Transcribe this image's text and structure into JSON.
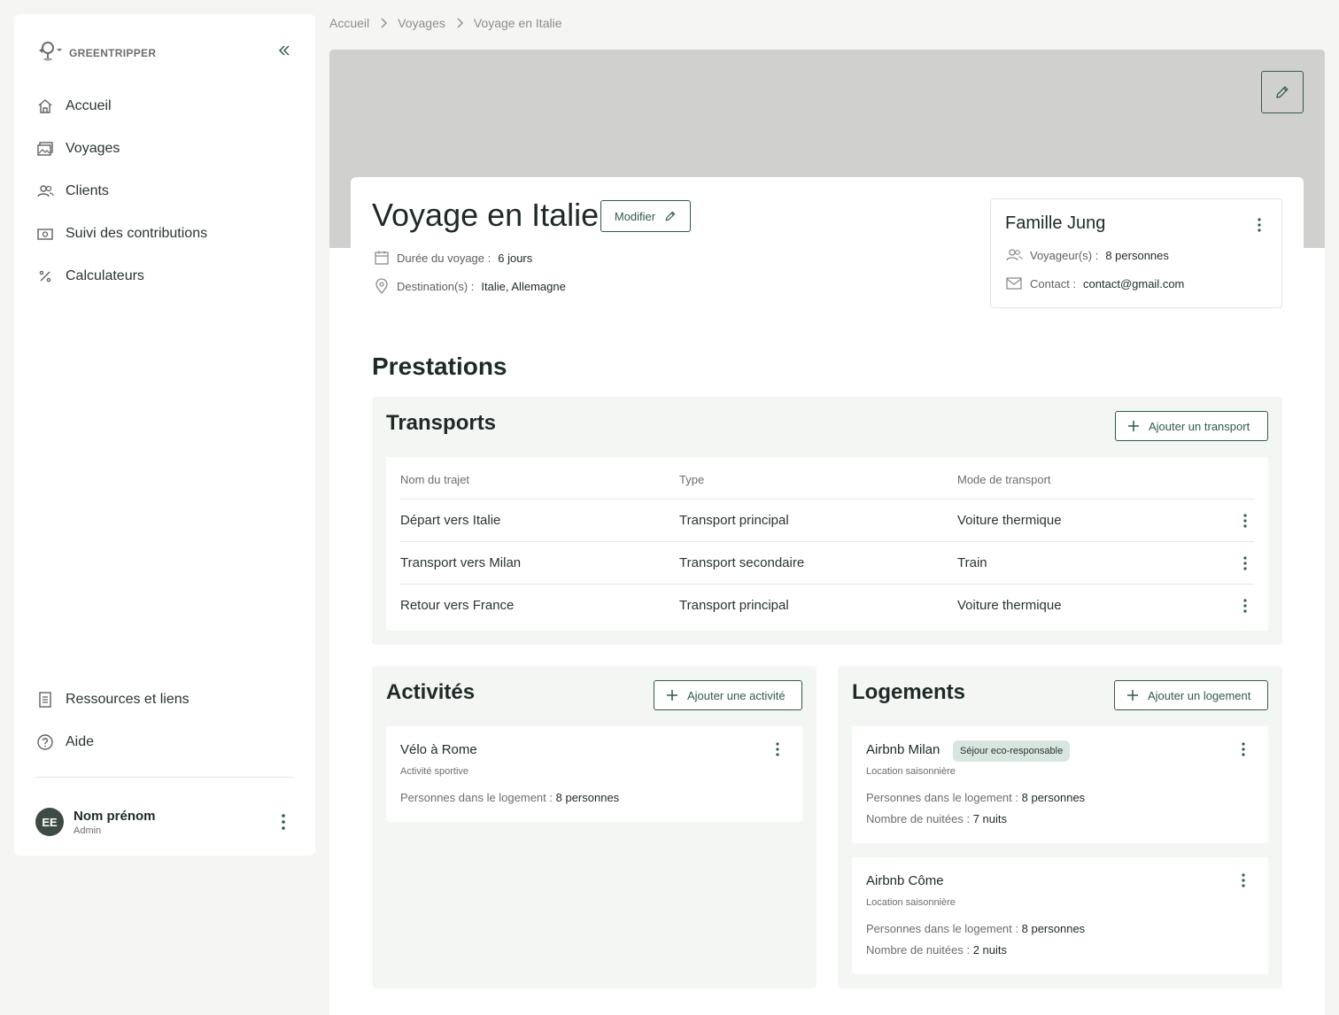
{
  "brand": {
    "name": "GREENTRIPPER"
  },
  "sidebar": {
    "items": [
      {
        "label": "Accueil",
        "icon": "home-icon"
      },
      {
        "label": "Voyages",
        "icon": "images-icon"
      },
      {
        "label": "Clients",
        "icon": "users-icon"
      },
      {
        "label": "Suivi des contributions",
        "icon": "money-icon"
      },
      {
        "label": "Calculateurs",
        "icon": "percent-icon"
      }
    ],
    "bottom_items": [
      {
        "label": "Ressources et liens",
        "icon": "document-icon"
      },
      {
        "label": "Aide",
        "icon": "help-icon"
      }
    ]
  },
  "user": {
    "initials": "EE",
    "name": "Nom prénom",
    "role": "Admin"
  },
  "breadcrumb": [
    "Accueil",
    "Voyages",
    "Voyage en Italie"
  ],
  "trip": {
    "title": "Voyage en Italie",
    "edit_label": "Modifier",
    "duration_label": "Durée du voyage :",
    "duration_value": "6 jours",
    "destination_label": "Destination(s) :",
    "destination_value": "Italie, Allemagne"
  },
  "client": {
    "name": "Famille Jung",
    "travelers_label": "Voyageur(s) :",
    "travelers_value": "8 personnes",
    "contact_label": "Contact :",
    "contact_value": "contact@gmail.com"
  },
  "prestations": {
    "title": "Prestations",
    "transports": {
      "title": "Transports",
      "add_label": "Ajouter un transport",
      "columns": [
        "Nom du trajet",
        "Type",
        "Mode de transport"
      ],
      "rows": [
        [
          "Départ vers Italie",
          "Transport principal",
          "Voiture thermique"
        ],
        [
          "Transport vers Milan",
          "Transport secondaire",
          "Train"
        ],
        [
          "Retour vers France",
          "Transport principal",
          "Voiture thermique"
        ]
      ]
    },
    "activites": {
      "title": "Activités",
      "add_label": "Ajouter une activité",
      "items": [
        {
          "title": "Vélo à Rome",
          "subtitle": "Activité sportive",
          "persons_label": "Personnes dans le logement :",
          "persons_value": "8 personnes"
        }
      ]
    },
    "logements": {
      "title": "Logements",
      "add_label": "Ajouter un logement",
      "items": [
        {
          "title": "Airbnb Milan",
          "badge": "Séjour eco-responsable",
          "subtitle": "Location saisonnière",
          "persons_label": "Personnes dans le logement :",
          "persons_value": "8 personnes",
          "nights_label": "Nombre de nuitées :",
          "nights_value": "7 nuits"
        },
        {
          "title": "Airbnb Côme",
          "subtitle": "Location saisonnière",
          "persons_label": "Personnes dans le logement :",
          "persons_value": "8 personnes",
          "nights_label": "Nombre de nuitées :",
          "nights_value": "2 nuits"
        }
      ]
    }
  },
  "colors": {
    "accent": "#2f5c4a",
    "banner": "#d0d1cf",
    "panel": "#f4f6f4",
    "badge": "#d9e6e0"
  }
}
